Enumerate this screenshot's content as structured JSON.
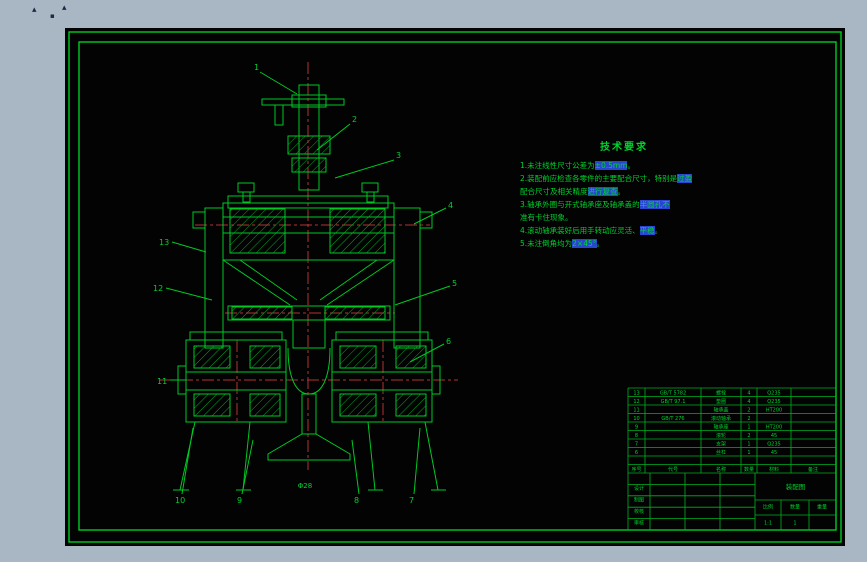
{
  "window": {
    "background": "#a9b7c5",
    "sheet_background": "#020302",
    "line_green": "#00c824",
    "frame_green": "#00cc22",
    "centerline_red": "#b23434",
    "text_green": "#00d22e",
    "highlight_blue": "#2747d0"
  },
  "artifacts": {
    "m1": "▴",
    "m2": "▪",
    "m3": "▴"
  },
  "tech": {
    "title": "技术要求",
    "lines": [
      {
        "pre": "1.未注线性尺寸公差为",
        "hl": "±0.5mm",
        "post": "。"
      },
      {
        "pre": "2.装配前应检查各零件的主要配合尺寸，特别是",
        "hl": "过盈",
        "post": ""
      },
      {
        "pre": "  配合尺寸及相关精度",
        "hl": "进行复查",
        "post": "。"
      },
      {
        "pre": "3.轴承外圈与开式轴承座及轴承盖的",
        "hl": "半圆孔不",
        "post": ""
      },
      {
        "pre": "  准有卡住现象",
        "hl": "",
        "post": "。"
      },
      {
        "pre": "4.滚动轴承装好后用手转动应灵活、",
        "hl": "平稳",
        "post": "。"
      },
      {
        "pre": "5.未注倒角均为",
        "hl": "2×45°",
        "post": "。"
      }
    ]
  },
  "callouts": [
    "1",
    "2",
    "3",
    "4",
    "5",
    "6",
    "7",
    "8",
    "9",
    "10",
    "11",
    "12",
    "13"
  ],
  "dimension": "Φ28",
  "titleblock": {
    "header": {
      "no": "序号",
      "code": "代号",
      "name": "名称",
      "qty": "数量",
      "mat": "材料",
      "note": "备注"
    },
    "parts": [
      {
        "no": "13",
        "code": "GB/T 5782",
        "name": "螺栓",
        "qty": "4",
        "mat": "Q235"
      },
      {
        "no": "12",
        "code": "GB/T 97.1",
        "name": "垫圈",
        "qty": "4",
        "mat": "Q235"
      },
      {
        "no": "11",
        "code": "",
        "name": "轴承盖",
        "qty": "2",
        "mat": "HT200"
      },
      {
        "no": "10",
        "code": "GB/T 276",
        "name": "滚动轴承",
        "qty": "2",
        "mat": ""
      },
      {
        "no": "9",
        "code": "",
        "name": "轴承座",
        "qty": "1",
        "mat": "HT200"
      },
      {
        "no": "8",
        "code": "",
        "name": "滚轮",
        "qty": "2",
        "mat": "45"
      },
      {
        "no": "7",
        "code": "",
        "name": "支架",
        "qty": "1",
        "mat": "Q235"
      },
      {
        "no": "6",
        "code": "",
        "name": "丝杠",
        "qty": "1",
        "mat": "45"
      }
    ],
    "fields": {
      "design": "设计",
      "draw": "制图",
      "check": "校核",
      "audit": "审核",
      "scale_label": "比例",
      "scale": "1:1",
      "qty_label": "数量",
      "qty": "1",
      "weight_label": "重量",
      "title": "装配图"
    }
  }
}
